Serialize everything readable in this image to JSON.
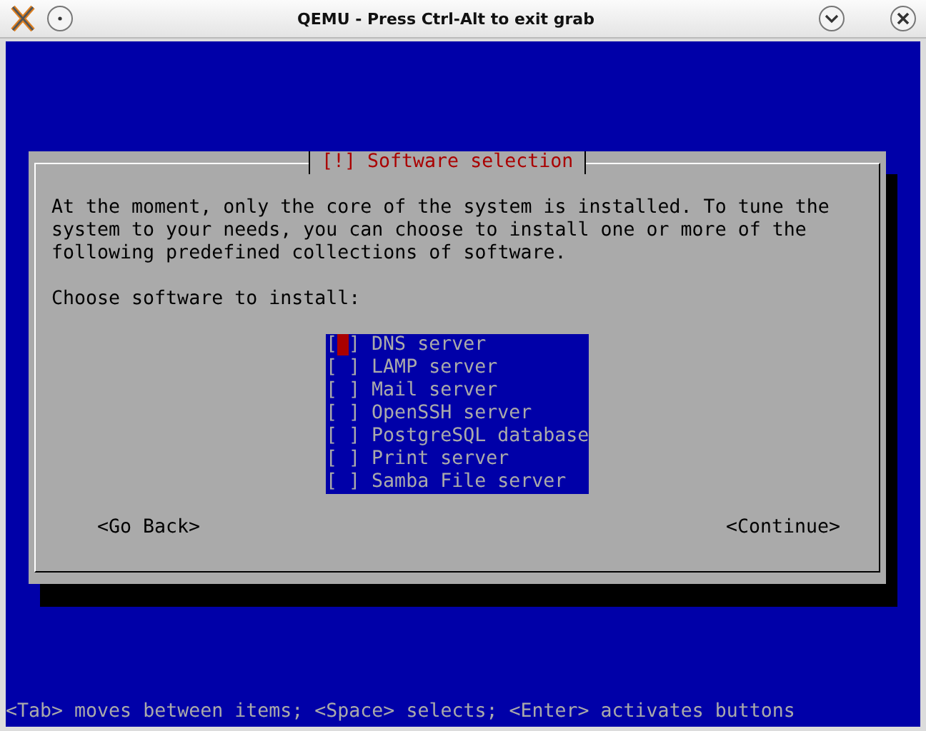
{
  "window": {
    "title": "QEMU - Press Ctrl-Alt to exit grab"
  },
  "dialog": {
    "title": "[!] Software selection",
    "message": "At the moment, only the core of the system is installed. To tune the\nsystem to your needs, you can choose to install one or more of the\nfollowing predefined collections of software.",
    "prompt": "Choose software to install:",
    "items": [
      {
        "mark": "[ ]",
        "label": "DNS server",
        "selected": true
      },
      {
        "mark": "[ ]",
        "label": "LAMP server",
        "selected": false
      },
      {
        "mark": "[ ]",
        "label": "Mail server",
        "selected": false
      },
      {
        "mark": "[ ]",
        "label": "OpenSSH server",
        "selected": false
      },
      {
        "mark": "[ ]",
        "label": "PostgreSQL database",
        "selected": false
      },
      {
        "mark": "[ ]",
        "label": "Print server",
        "selected": false
      },
      {
        "mark": "[ ]",
        "label": "Samba File server",
        "selected": false
      }
    ],
    "buttons": [
      "<Go Back>",
      "<Continue>"
    ]
  },
  "status_bar": "<Tab> moves between items; <Space> selects; <Enter> activates buttons"
}
